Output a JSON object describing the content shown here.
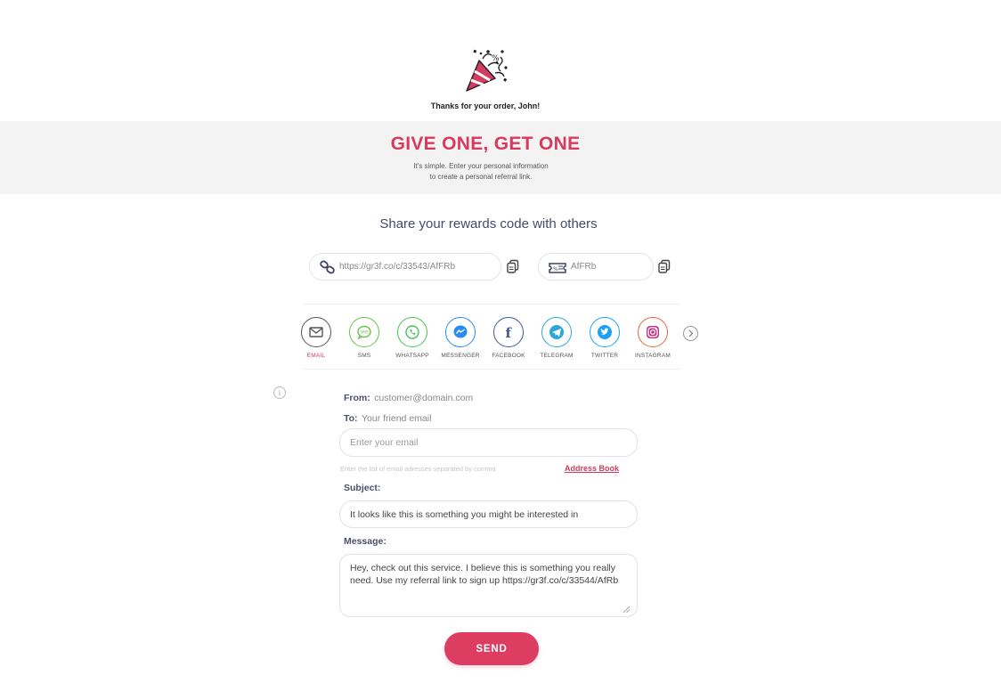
{
  "header": {
    "icon": "party-popper-icon",
    "thanks_text": "Thanks for your order, John!"
  },
  "promo": {
    "title": "GIVE ONE, GET ONE",
    "subtitle_line1": "It's simple. Enter your personal information",
    "subtitle_line2": "to create a personal referral link."
  },
  "share": {
    "title": "Share your rewards code with others",
    "referral_link": "https://gr3f.co/c/33543/AfFRb",
    "referral_link_icon": "link-icon",
    "coupon_code": "AfFRb",
    "coupon_code_icon": "ticket-icon",
    "copy_icon": "copy-icon"
  },
  "channels": [
    {
      "label": "EMAIL",
      "icon": "email-icon",
      "color": "#555555",
      "active": true
    },
    {
      "label": "SMS",
      "icon": "sms-icon",
      "color": "#6cc04a"
    },
    {
      "label": "WHATSAPP",
      "icon": "whatsapp-icon",
      "color": "#43c553"
    },
    {
      "label": "MESSENGER",
      "icon": "messenger-icon",
      "color": "#2a8bf2"
    },
    {
      "label": "FACEBOOK",
      "icon": "facebook-icon",
      "color": "#3b5998"
    },
    {
      "label": "TELEGRAM",
      "icon": "telegram-icon",
      "color": "#2ea6da"
    },
    {
      "label": "TWITTER",
      "icon": "twitter-icon",
      "color": "#1da1f2"
    },
    {
      "label": "INSTAGRAM",
      "icon": "instagram-icon",
      "color": "#c13584"
    }
  ],
  "email_form": {
    "from_label": "From:",
    "from_value": "customer@domain.com",
    "to_label": "To:",
    "to_value": "Your friend email",
    "email_placeholder": "Enter your email",
    "email_hint": "Enter the list of email adresses separated by comma",
    "address_book_label": "Address Book",
    "subject_label": "Subject:",
    "subject_value": "It looks like this is something you might be interested in",
    "message_label": "Message:",
    "message_value": "Hey, check out this service. I believe this is something you really need. Use my referral link to sign up https://gr3f.co/c/33544/AfRb",
    "send_label": "SEND"
  },
  "colors": {
    "accent": "#dc3d61",
    "band_background": "#f3f3f3"
  }
}
